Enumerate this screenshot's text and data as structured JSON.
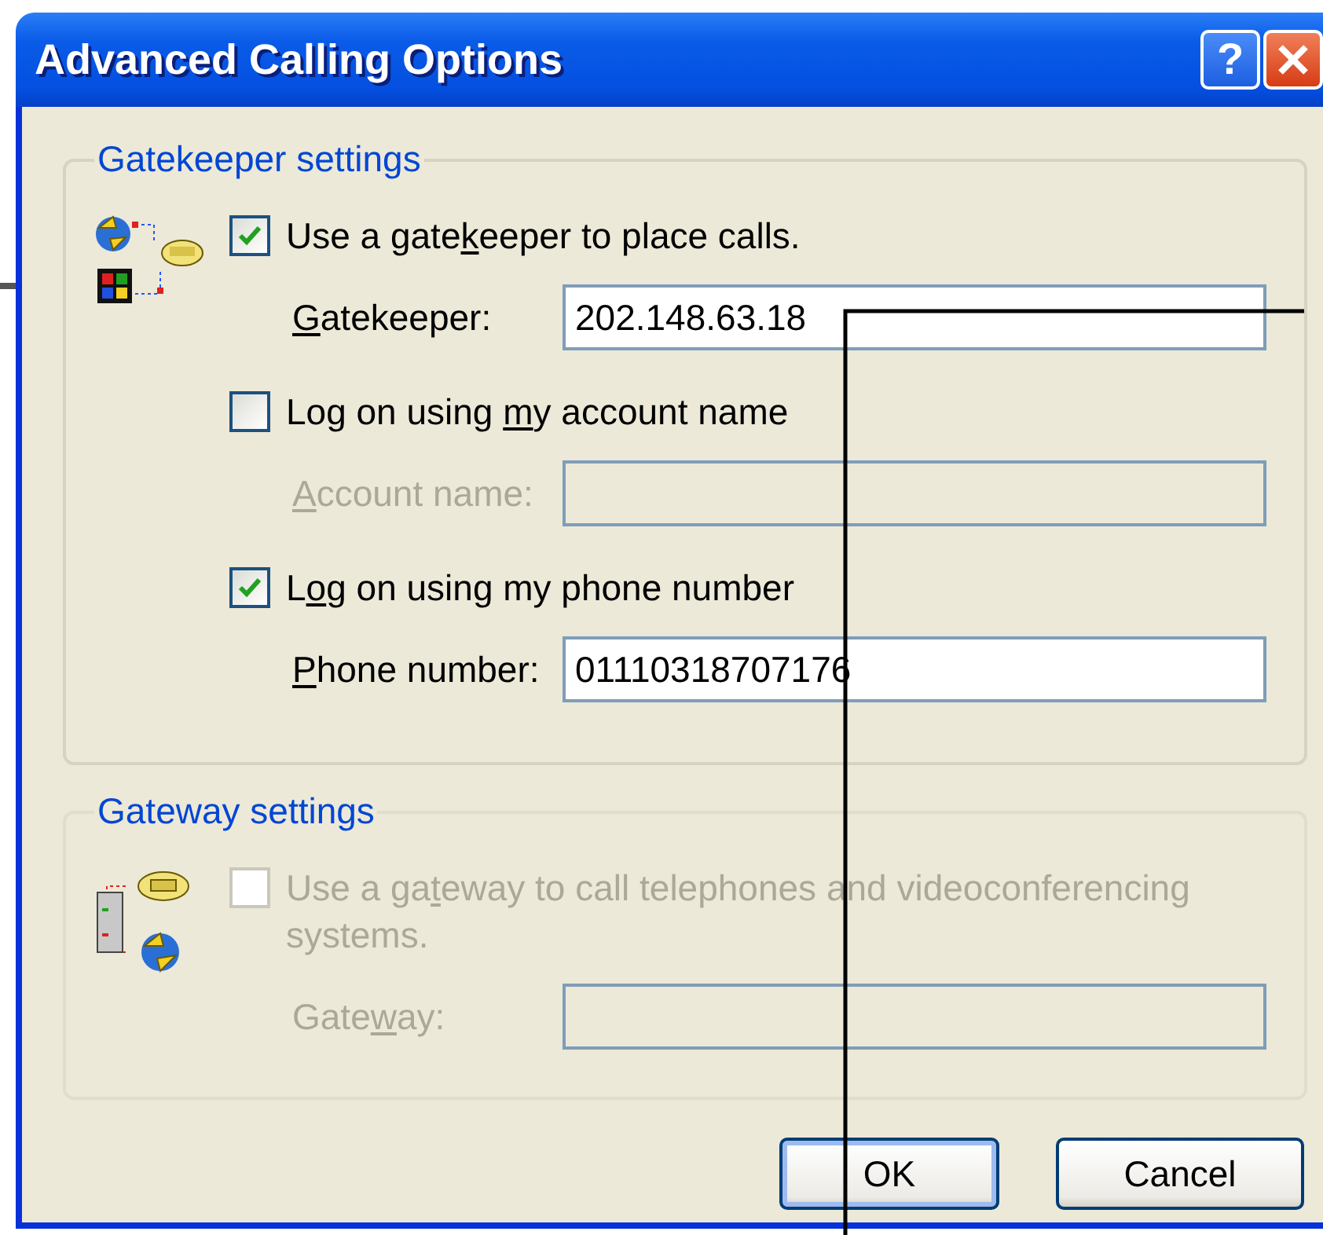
{
  "window": {
    "title": "Advanced Calling Options",
    "help_button": "?"
  },
  "groups": [
    {
      "title": "Gatekeeper settings",
      "disabled": false,
      "items": [
        {
          "kind": "checkbox",
          "label": {
            "before": "Use a gate",
            "key": "k",
            "after": "eeper to place calls."
          },
          "checked": true,
          "disabled": false
        },
        {
          "kind": "field",
          "label": {
            "key": "G",
            "after": "atekeeper:"
          },
          "value": "202.148.63.18",
          "disabled": false
        },
        {
          "kind": "checkbox",
          "label": {
            "before": "Log on using ",
            "key": "m",
            "after": "y account name"
          },
          "checked": false,
          "disabled": false
        },
        {
          "kind": "field",
          "label": {
            "key": "A",
            "after": "ccount name:"
          },
          "disabled": true
        },
        {
          "kind": "checkbox",
          "label": {
            "before": "L",
            "key": "o",
            "after": "g on using my phone number"
          },
          "checked": true,
          "disabled": false
        },
        {
          "kind": "field",
          "label": {
            "key": "P",
            "after": "hone number:"
          },
          "value": "01110318707176",
          "disabled": false
        }
      ]
    },
    {
      "title": "Gateway settings",
      "disabled": true,
      "items": [
        {
          "kind": "checkbox",
          "label": {
            "before": "Use a ga",
            "key": "t",
            "after": "eway to call telephones and videoconferencing systems."
          },
          "checked": false,
          "disabled": true
        },
        {
          "kind": "field",
          "label": {
            "before": "Gate",
            "key": "w",
            "after": "ay:"
          },
          "disabled": true
        }
      ]
    }
  ],
  "buttons": [
    {
      "label": "OK",
      "default": true
    },
    {
      "label": "Cancel",
      "default": false
    }
  ]
}
